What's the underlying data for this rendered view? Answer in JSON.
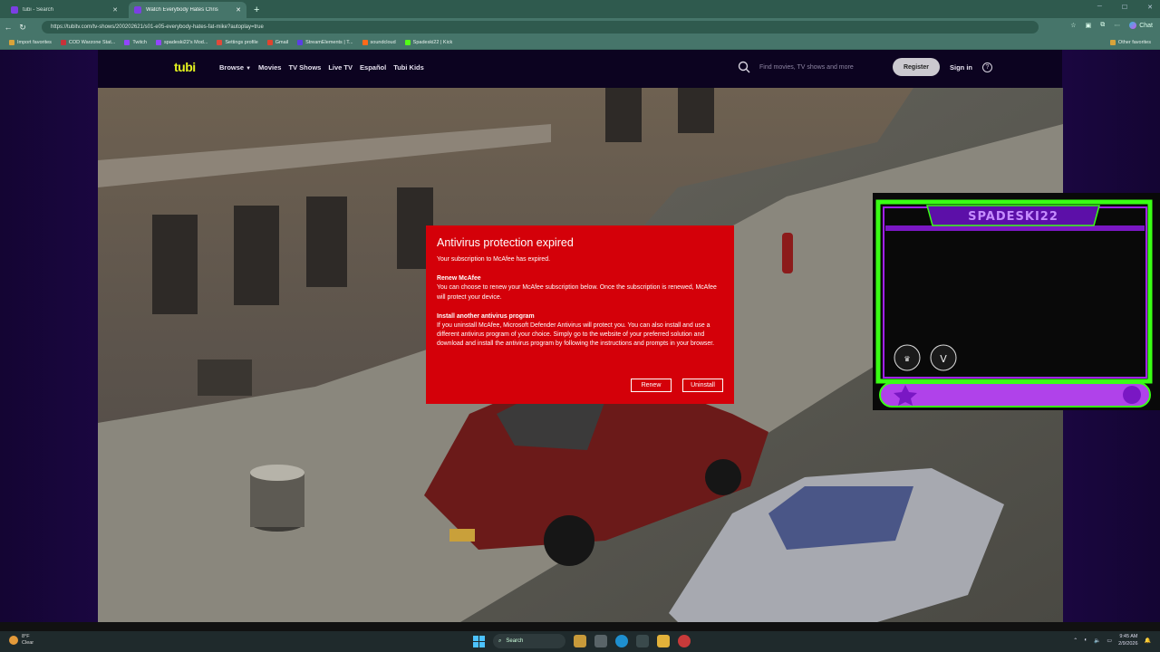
{
  "browser": {
    "tabs": [
      {
        "title": "tubi - Search",
        "active": false,
        "favicon_color": "#7b3fe4"
      },
      {
        "title": "Watch Everybody Hates Chris",
        "active": true,
        "favicon_color": "#7b3fe4"
      }
    ],
    "url": "https://tubitv.com/tv-shows/200202621/s01-e05-everybody-hates-fat-mike?autoplay=true",
    "copilot_label": "Chat",
    "bookmarks": [
      {
        "label": "Import favorites",
        "color": "#d9a33a"
      },
      {
        "label": "COD Warzone Stat...",
        "color": "#c8323a"
      },
      {
        "label": "Twitch",
        "color": "#9146ff"
      },
      {
        "label": "spadeski22's Mod...",
        "color": "#9146ff"
      },
      {
        "label": "Settings profile",
        "color": "#e04a3a"
      },
      {
        "label": "Gmail",
        "color": "#e0442e"
      },
      {
        "label": "StreamElements | T...",
        "color": "#5a3ee6"
      },
      {
        "label": "soundcloud",
        "color": "#ff6a1a"
      },
      {
        "label": "Spadeski22 | Kick",
        "color": "#53fc18"
      }
    ],
    "other_favorites": "Other favorites"
  },
  "tubi": {
    "logo": "tubi",
    "nav": [
      "Browse",
      "Movies",
      "TV Shows",
      "Live TV",
      "Español",
      "Tubi Kids"
    ],
    "search_placeholder": "Find movies, TV shows and more",
    "register": "Register",
    "signin": "Sign in",
    "help": "?"
  },
  "dialog": {
    "title": "Antivirus protection expired",
    "subtitle": "Your subscription to McAfee has expired.",
    "renew_heading": "Renew McAfee",
    "renew_body": "You can choose to renew your McAfee subscription below. Once the subscription is renewed, McAfee will protect your device.",
    "install_heading": "Install another antivirus program",
    "install_body": "If you uninstall McAfee, Microsoft Defender Antivirus will protect you. You can also install and use a different antivirus program of your choice. Simply go to the website of your preferred solution and download and install the antivirus program by following the instructions and prompts in your browser.",
    "renew_button": "Renew",
    "uninstall_button": "Uninstall",
    "background_color": "#d40009"
  },
  "overlay": {
    "name_text": "SPADESKI22",
    "accent_green": "#39ff14",
    "accent_purple": "#a020f0"
  },
  "taskbar": {
    "weather_temp": "8°F",
    "weather_cond": "Clear",
    "search_label": "Search",
    "time": "9:45 AM",
    "date": "2/9/2026"
  }
}
